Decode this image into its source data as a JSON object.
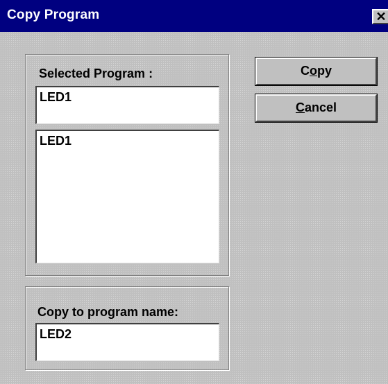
{
  "window": {
    "title": "Copy Program",
    "close_glyph": "✕"
  },
  "selected_group": {
    "label": "Selected Program :",
    "field_value": "LED1",
    "list_items": [
      "LED1"
    ]
  },
  "target_group": {
    "label": "Copy to program name:",
    "field_value": "LED2"
  },
  "buttons": {
    "copy": {
      "pre": "C",
      "underlined": "o",
      "post": "py"
    },
    "cancel": {
      "pre": "",
      "underlined": "C",
      "post": "ancel"
    }
  }
}
